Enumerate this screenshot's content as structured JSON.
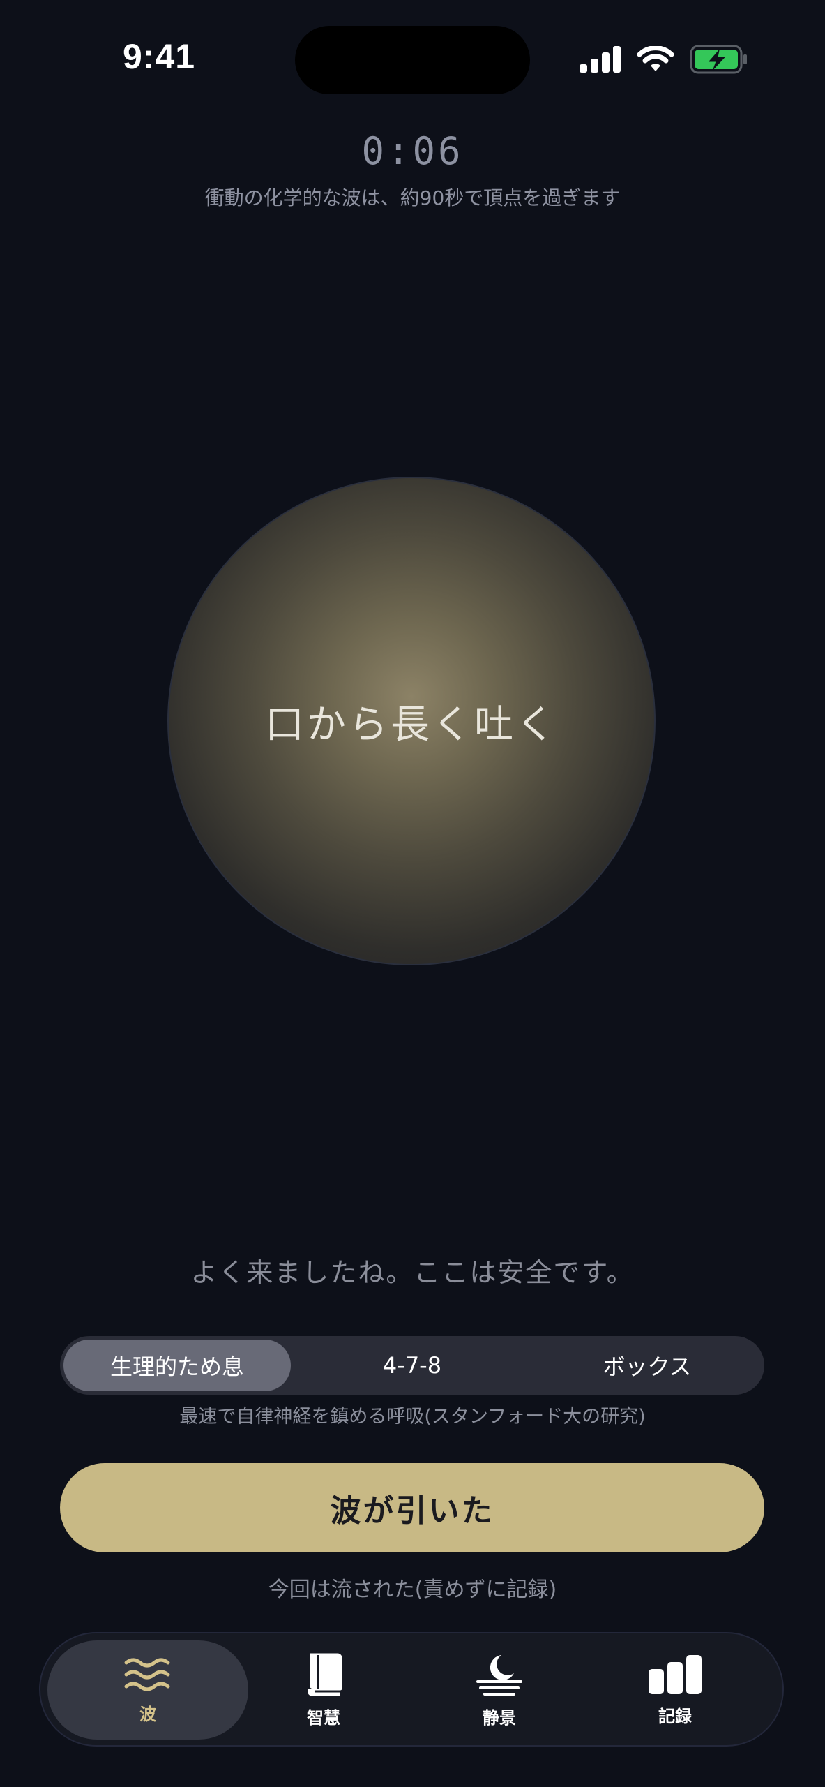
{
  "status_bar": {
    "time": "9:41"
  },
  "timer": {
    "elapsed": "0:06"
  },
  "caption": "衝動の化学的な波は、約90秒で頂点を過ぎます",
  "orb": {
    "instruction": "口から長く吐く"
  },
  "welcome_message": "よく来ましたね。ここは安全です。",
  "breathing_modes": {
    "options": [
      "生理的ため息",
      "4-7-8",
      "ボックス"
    ],
    "selected": "生理的ため息",
    "description": "最速で自律神経を鎮める呼吸(スタンフォード大の研究)"
  },
  "primary_action": {
    "label": "波が引いた"
  },
  "secondary_action": {
    "label": "今回は流された(責めずに記録)"
  },
  "tab_bar": {
    "items": [
      {
        "label": "波",
        "icon": "waves-icon"
      },
      {
        "label": "智慧",
        "icon": "book-icon"
      },
      {
        "label": "静景",
        "icon": "moon-icon"
      },
      {
        "label": "記録",
        "icon": "bar-chart-icon"
      }
    ],
    "selected": "波"
  },
  "colors": {
    "background": "#0d1019",
    "accent": "#c8b985",
    "battery": "#34c759"
  }
}
